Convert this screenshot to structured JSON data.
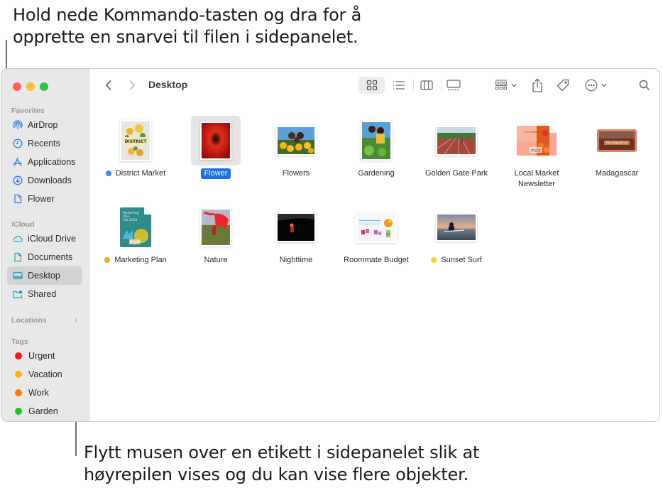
{
  "callouts": {
    "top": "Hold nede Kommando-tasten og dra for å opprette en snarvei til filen i sidepanelet.",
    "bottom": "Flytt musen over en etikett i sidepanelet slik at høyrepilen vises og du kan vise flere objekter."
  },
  "window": {
    "title": "Desktop"
  },
  "sidebar": {
    "favorites_label": "Favorites",
    "favorites": [
      {
        "label": "AirDrop",
        "icon": "airdrop-icon"
      },
      {
        "label": "Recents",
        "icon": "clock-icon"
      },
      {
        "label": "Applications",
        "icon": "applications-icon"
      },
      {
        "label": "Downloads",
        "icon": "download-icon"
      },
      {
        "label": "Flower",
        "icon": "document-icon"
      }
    ],
    "icloud_label": "iCloud",
    "icloud": [
      {
        "label": "iCloud Drive",
        "icon": "cloud-icon"
      },
      {
        "label": "Documents",
        "icon": "document-icon"
      },
      {
        "label": "Desktop",
        "icon": "desktop-icon",
        "selected": true
      },
      {
        "label": "Shared",
        "icon": "shared-folder-icon"
      }
    ],
    "locations_label": "Locations",
    "tags_label": "Tags",
    "tags": [
      {
        "label": "Urgent",
        "color": "#f5141e"
      },
      {
        "label": "Vacation",
        "color": "#f6b80e"
      },
      {
        "label": "Work",
        "color": "#fb7a0d"
      },
      {
        "label": "Garden",
        "color": "#1ac02d"
      }
    ]
  },
  "toolbar": {
    "back": "back-icon",
    "forward": "forward-icon",
    "views": [
      "icon-view",
      "list-view",
      "column-view",
      "gallery-view"
    ],
    "active_view": "icon-view"
  },
  "files": [
    {
      "name": "District Market",
      "tag_color": "#2f8cf5"
    },
    {
      "name": "Flower",
      "selected": true
    },
    {
      "name": "Flowers"
    },
    {
      "name": "Gardening"
    },
    {
      "name": "Golden Gate Park"
    },
    {
      "name": "Local Market Newsletter"
    },
    {
      "name": "Madagascar"
    },
    {
      "name": "Marketing Plan",
      "tag_color": "#f9a12a"
    },
    {
      "name": "Nature"
    },
    {
      "name": "Nighttime"
    },
    {
      "name": "Roommate Budget"
    },
    {
      "name": "Sunset Surf",
      "tag_color": "#f8d130"
    }
  ]
}
